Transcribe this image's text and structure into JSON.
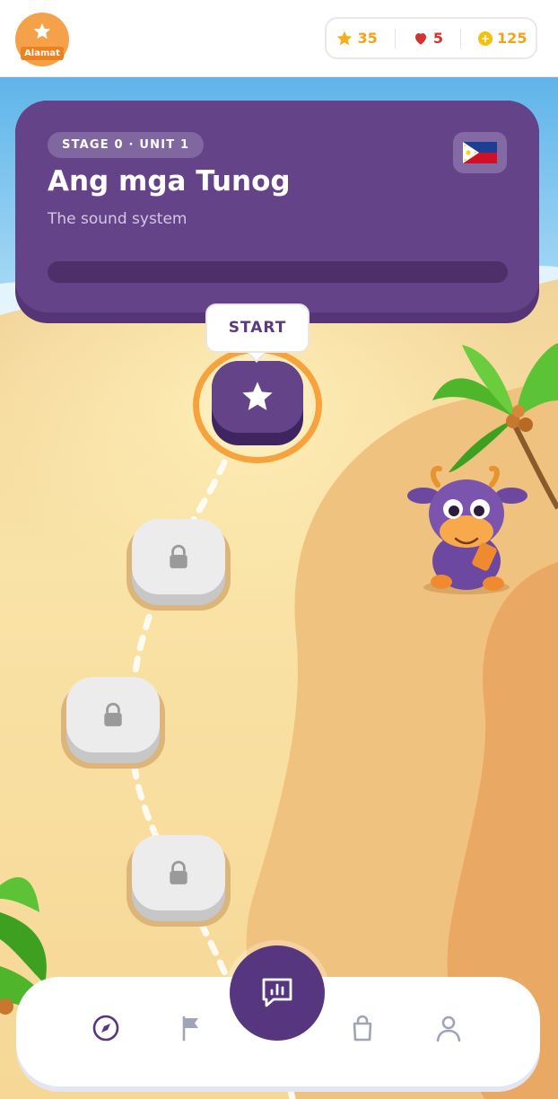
{
  "header": {
    "logo_label": "Alamat",
    "stats": {
      "stars": "35",
      "hearts": "5",
      "coins": "125"
    }
  },
  "unit": {
    "stage_label": "STAGE 0 · UNIT 1",
    "title": "Ang mga Tunog",
    "subtitle": "The sound system",
    "flag_icon": "philippines-flag-icon",
    "progress": 0
  },
  "path": {
    "start_label": "START",
    "nodes": [
      {
        "state": "active",
        "icon": "star-icon"
      },
      {
        "state": "locked",
        "icon": "lock-icon"
      },
      {
        "state": "locked",
        "icon": "lock-icon"
      },
      {
        "state": "locked",
        "icon": "lock-icon"
      }
    ]
  },
  "nav": {
    "items": [
      {
        "name": "explore",
        "icon": "compass-icon"
      },
      {
        "name": "goals",
        "icon": "flag-icon"
      },
      {
        "name": "chat",
        "icon": "chat-bars-icon"
      },
      {
        "name": "shop",
        "icon": "shopping-bag-icon"
      },
      {
        "name": "profile",
        "icon": "person-icon"
      }
    ]
  },
  "colors": {
    "brand_purple": "#654388",
    "accent_orange": "#f5a14a",
    "sand": "#f7dfa0",
    "sky": "#7ec6ef"
  }
}
